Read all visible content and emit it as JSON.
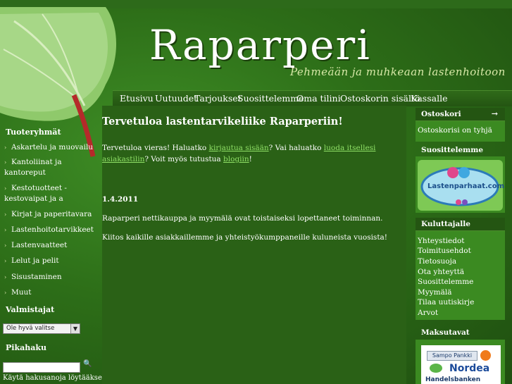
{
  "brand": {
    "logo": "Raparperi",
    "tagline": "Pehmeään ja muhkeaan lastenhoitoon"
  },
  "nav": [
    "Etusivu",
    "Uutuudet",
    "Tarjoukset",
    "Suosittelemme",
    "Oma tilini",
    "Ostoskorin sisältö",
    "Kassalle"
  ],
  "left": {
    "categories_title": "Tuoteryhmät",
    "categories": [
      "Askartelu ja muovailu",
      "Kantoliinat ja kantoreput",
      "Kestotuotteet - kestovaipat ja a",
      "Kirjat ja paperitavara",
      "Lastenhoitotarvikkeet",
      "Lastenvaatteet",
      "Lelut ja pelit",
      "Sisustaminen",
      "Muut"
    ],
    "manufacturers_title": "Valmistajat",
    "manufacturer_select": "Ole hyvä valitse",
    "quicksearch_title": "Pikahaku",
    "search_hint": "Käytä hakusanoja löytääksesi"
  },
  "main": {
    "heading": "Tervetuloa lastentarvikeliike Raparperiin!",
    "welcome_pre": "Tervetuloa vieras! Haluatko ",
    "login_link": "kirjautua sisään",
    "welcome_mid": "? Vai haluatko ",
    "create_link": "luoda itsellesi asiakastilin",
    "welcome_post": "? Voit myös tutustua ",
    "blog_link": "blogiin",
    "welcome_end": "!",
    "date": "1.4.2011",
    "news1": "Raparperi nettikauppa ja myymälä ovat toistaiseksi lopettaneet toiminnan.",
    "news2": "Kiitos kaikille asiakkaillemme ja yhteistyökumppaneille kuluneista vuosista!"
  },
  "right": {
    "cart_title": "Ostoskori",
    "cart_text": "Ostoskorisi on tyhjä",
    "recommend_title": "Suosittelemme",
    "recommend_logo": "Lastenparhaat.com",
    "consumer_title": "Kuluttajalle",
    "consumer_links": [
      "Yhteystiedot",
      "Toimitusehdot",
      "Tietosuoja",
      "Ota yhteyttä",
      "Suosittelemme",
      "Myymälä",
      "Tilaa uutiskirje",
      "Arvot"
    ],
    "payment_title": "Maksutavat",
    "payment_banks": [
      "Sampo Pankki",
      "Nordea",
      "Handelsbanken"
    ]
  },
  "colors": {
    "link": "#8fe066",
    "background": "#2d6e18",
    "header": "#245512"
  }
}
